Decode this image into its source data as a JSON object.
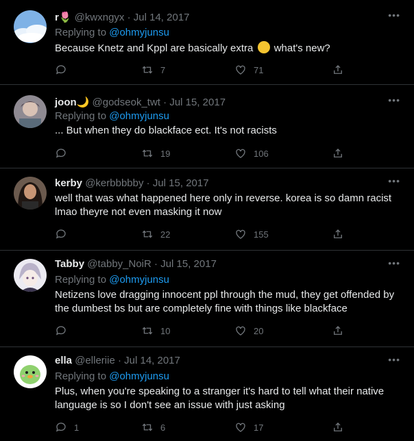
{
  "tweets": [
    {
      "name": "r🌷",
      "handle": "@kwxngyx",
      "date": "Jul 14, 2017",
      "replying_prefix": "Replying to",
      "replying_to": "@ohmyjunsu",
      "text_before": "Because Knetz and Kppl are basically extra",
      "text_after": "what's new?",
      "emoji": "yawning-face-emoji",
      "replies": "",
      "retweets": "7",
      "likes": "71"
    },
    {
      "name": "joon🌙",
      "handle": "@godseok_twt",
      "date": "Jul 15, 2017",
      "replying_prefix": "Replying to",
      "replying_to": "@ohmyjunsu",
      "text": "... But when they do blackface ect. It's not racists",
      "replies": "",
      "retweets": "19",
      "likes": "106"
    },
    {
      "name": "kerby",
      "handle": "@kerbbbbby",
      "date": "Jul 15, 2017",
      "text": "well that was what happened here only in reverse. korea is so damn racist lmao theyre not even masking it now",
      "replies": "",
      "retweets": "22",
      "likes": "155"
    },
    {
      "name": "Tabby",
      "handle": "@tabby_NoiR",
      "date": "Jul 15, 2017",
      "replying_prefix": "Replying to",
      "replying_to": "@ohmyjunsu",
      "text": "Netizens love dragging innocent ppl through the mud, they get offended by the dumbest bs but are completely fine with things like blackface",
      "replies": "",
      "retweets": "10",
      "likes": "20"
    },
    {
      "name": "ella",
      "handle": "@elleriie",
      "date": "Jul 14, 2017",
      "replying_prefix": "Replying to",
      "replying_to": "@ohmyjunsu",
      "text": "Plus, when you're speaking to a stranger it's hard to tell what their native language is so I don't see an issue with just asking",
      "replies": "1",
      "retweets": "6",
      "likes": "17"
    }
  ],
  "separator": " · ",
  "more_label": "•••",
  "colors": {
    "background": "#000000",
    "text": "#e7e9ea",
    "muted": "#71767b",
    "link": "#1d9bf0",
    "divider": "#2f3336"
  }
}
